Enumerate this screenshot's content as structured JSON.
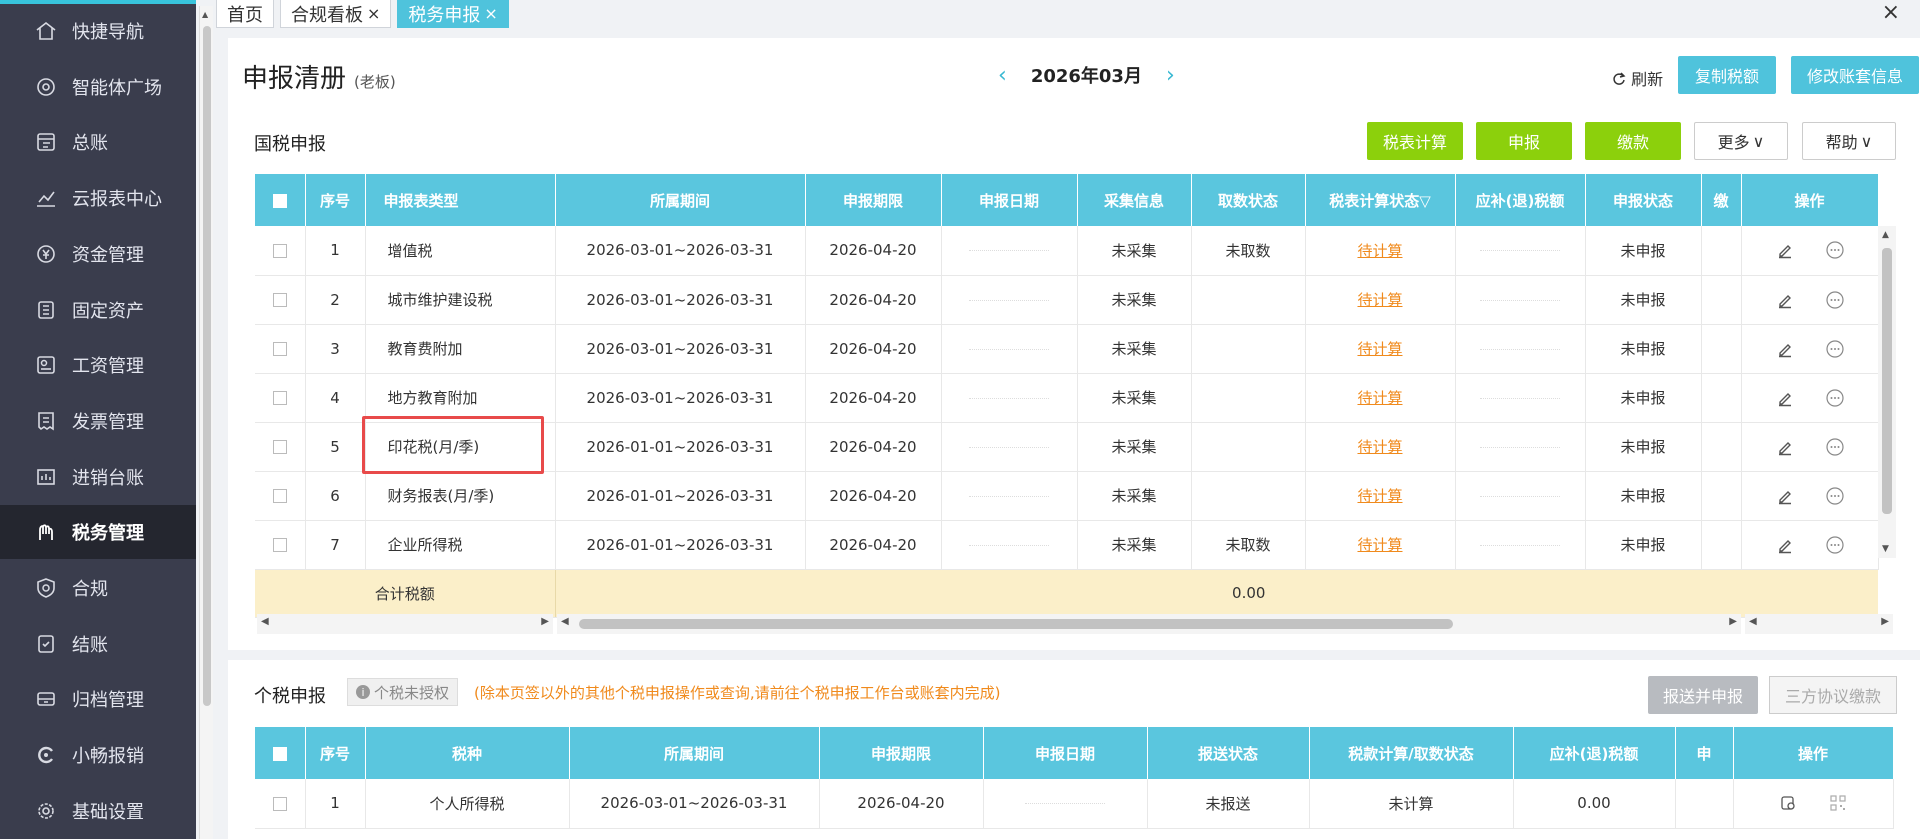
{
  "sidebar": {
    "items": [
      {
        "label": "快捷导航",
        "icon": "home-icon"
      },
      {
        "label": "智能体广场",
        "icon": "agent-icon"
      },
      {
        "label": "总账",
        "icon": "ledger-icon"
      },
      {
        "label": "云报表中心",
        "icon": "chart-icon"
      },
      {
        "label": "资金管理",
        "icon": "money-icon"
      },
      {
        "label": "固定资产",
        "icon": "asset-icon"
      },
      {
        "label": "工资管理",
        "icon": "salary-icon"
      },
      {
        "label": "发票管理",
        "icon": "invoice-icon"
      },
      {
        "label": "进销台账",
        "icon": "inventory-icon"
      },
      {
        "label": "税务管理",
        "icon": "tax-icon"
      },
      {
        "label": "合规",
        "icon": "shield-icon"
      },
      {
        "label": "结账",
        "icon": "closing-icon"
      },
      {
        "label": "归档管理",
        "icon": "archive-icon"
      },
      {
        "label": "小畅报销",
        "icon": "reimburse-icon"
      },
      {
        "label": "基础设置",
        "icon": "gear-icon"
      }
    ]
  },
  "tabs": [
    {
      "label": "首页"
    },
    {
      "label": "合规看板",
      "close": "×"
    },
    {
      "label": "税务申报",
      "close": "×"
    }
  ],
  "window_close": "×",
  "header": {
    "title": "申报清册",
    "subtitle": "(老板)",
    "period": "2026年03月",
    "prev": "‹",
    "next": "›",
    "refresh": "刷新",
    "copy_tax": "复制税额",
    "edit_account": "修改账套信息"
  },
  "national": {
    "title": "国税申报",
    "buttons": {
      "calc": "税表计算",
      "declare": "申报",
      "pay": "缴款",
      "more": "更多",
      "help": "帮助"
    },
    "columns": [
      "序号",
      "申报表类型",
      "所属期间",
      "申报期限",
      "申报日期",
      "采集信息",
      "取数状态",
      "税表计算状态",
      "应补(退)税额",
      "申报状态",
      "缴",
      "操作"
    ],
    "rows": [
      {
        "no": "1",
        "type": "增值税",
        "period": "2026-03-01~2026-03-31",
        "deadline": "2026-04-20",
        "collect": "未采集",
        "fetch": "未取数",
        "calc": "待计算",
        "status": "未申报"
      },
      {
        "no": "2",
        "type": "城市维护建设税",
        "period": "2026-03-01~2026-03-31",
        "deadline": "2026-04-20",
        "collect": "未采集",
        "fetch": "",
        "calc": "待计算",
        "status": "未申报"
      },
      {
        "no": "3",
        "type": "教育费附加",
        "period": "2026-03-01~2026-03-31",
        "deadline": "2026-04-20",
        "collect": "未采集",
        "fetch": "",
        "calc": "待计算",
        "status": "未申报"
      },
      {
        "no": "4",
        "type": "地方教育附加",
        "period": "2026-03-01~2026-03-31",
        "deadline": "2026-04-20",
        "collect": "未采集",
        "fetch": "",
        "calc": "待计算",
        "status": "未申报"
      },
      {
        "no": "5",
        "type": "印花税(月/季)",
        "period": "2026-01-01~2026-03-31",
        "deadline": "2026-04-20",
        "collect": "未采集",
        "fetch": "",
        "calc": "待计算",
        "status": "未申报"
      },
      {
        "no": "6",
        "type": "财务报表(月/季)",
        "period": "2026-01-01~2026-03-31",
        "deadline": "2026-04-20",
        "collect": "未采集",
        "fetch": "",
        "calc": "待计算",
        "status": "未申报"
      },
      {
        "no": "7",
        "type": "企业所得税",
        "period": "2026-01-01~2026-03-31",
        "deadline": "2026-04-20",
        "collect": "未采集",
        "fetch": "未取数",
        "calc": "待计算",
        "status": "未申报"
      }
    ],
    "total_label": "合计税额",
    "total_value": "0.00"
  },
  "personal": {
    "title": "个税申报",
    "badge": "个税未授权",
    "notice": "(除本页签以外的其他个税申报操作或查询,请前往个税申报工作台或账套内完成)",
    "buttons": {
      "submit": "报送并申报",
      "tripartite": "三方协议缴款"
    },
    "columns": [
      "序号",
      "税种",
      "所属期间",
      "申报期限",
      "申报日期",
      "报送状态",
      "税款计算/取数状态",
      "应补(退)税额",
      "申",
      "操作"
    ],
    "rows": [
      {
        "no": "1",
        "type": "个人所得税",
        "period": "2026-03-01~2026-03-31",
        "deadline": "2026-04-20",
        "send": "未报送",
        "calc": "未计算",
        "amount": "0.00"
      }
    ]
  }
}
